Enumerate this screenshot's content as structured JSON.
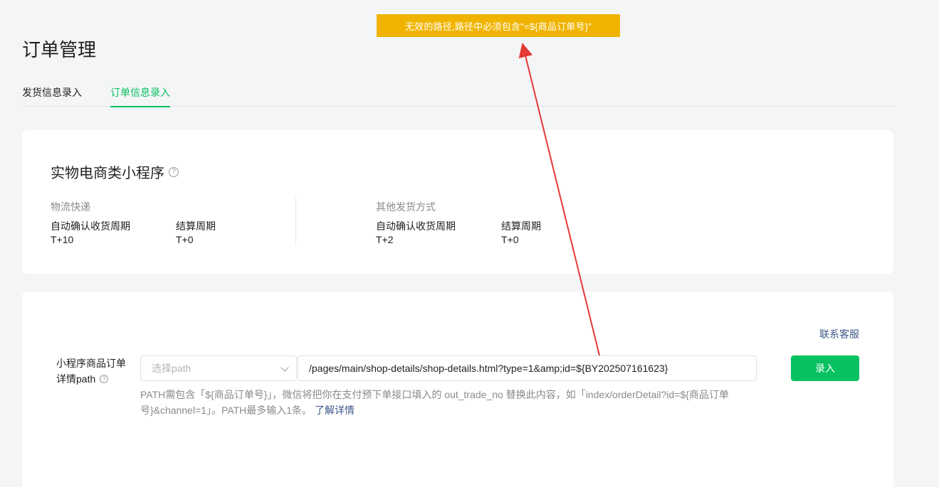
{
  "toast": {
    "message": "无效的路径,路径中必须包含\"=${商品订单号}\""
  },
  "page": {
    "title": "订单管理"
  },
  "tabs": [
    {
      "label": "发货信息录入",
      "active": false
    },
    {
      "label": "订单信息录入",
      "active": true
    }
  ],
  "mini_program": {
    "title": "实物电商类小程序",
    "help_icon": "question-circle-icon",
    "groups": [
      {
        "label": "物流快递",
        "fields": [
          {
            "label": "自动确认收货周期",
            "value": "T+10"
          },
          {
            "label": "结算周期",
            "value": "T+0"
          }
        ]
      },
      {
        "label": "其他发货方式",
        "fields": [
          {
            "label": "自动确认收货周期",
            "value": "T+2"
          },
          {
            "label": "结算周期",
            "value": "T+0"
          }
        ]
      }
    ]
  },
  "path_form": {
    "contact_label": "联系客服",
    "label_line1": "小程序商品订单",
    "label_line2": "详情path",
    "select_placeholder": "选择path",
    "input_value": "/pages/main/shop-details/shop-details.html?type=1&amp;id=${BY202507161623}",
    "submit_label": "录入",
    "hint_text": "PATH需包含「${商品订单号}」，微信将把你在支付预下单接口填入的 out_trade_no 替换此内容，如「index/orderDetail?id=${商品订单号}&channel=1」。PATH最多输入1条。",
    "hint_link": "了解详情"
  },
  "colors": {
    "accent": "#07c160",
    "toast_bg": "#f0b400",
    "link": "#3e5a8a",
    "annotation_arrow": "#e53935"
  }
}
